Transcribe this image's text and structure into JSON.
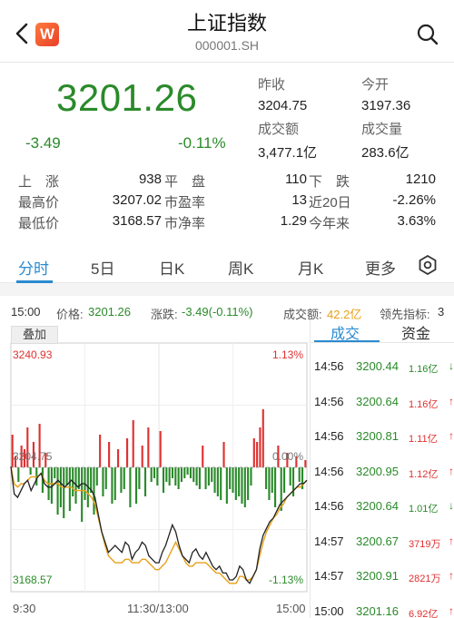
{
  "header": {
    "title": "上证指数",
    "code": "000001.SH",
    "logo_text": "W"
  },
  "quote": {
    "price": "3201.26",
    "change": "-3.49",
    "change_pct": "-0.11%",
    "prev_close_label": "昨收",
    "prev_close": "3204.75",
    "open_label": "今开",
    "open": "3197.36",
    "turnover_label": "成交额",
    "turnover": "3,477.1亿",
    "volume_label": "成交量",
    "volume": "283.6亿"
  },
  "stats": [
    {
      "l1": "上　涨",
      "v1": "938",
      "l2": "平　盘",
      "v2": "110",
      "l3": "下　跌",
      "v3": "1210"
    },
    {
      "l1": "最高价",
      "v1": "3207.02",
      "l2": "市盈率",
      "v2": "13",
      "l3": "近20日",
      "v3": "-2.26%"
    },
    {
      "l1": "最低价",
      "v1": "3168.57",
      "l2": "市净率",
      "v2": "1.29",
      "l3": "今年来",
      "v3": "3.63%"
    }
  ],
  "tabs": [
    "分时",
    "5日",
    "日K",
    "周K",
    "月K",
    "更多"
  ],
  "info": {
    "time": "15:00",
    "price_label": "价格:",
    "price": "3201.26",
    "chg_label": "涨跌:",
    "chg": "-3.49(-0.11%)",
    "amt_label": "成交额:",
    "amt": "42.2亿",
    "lead_label": "领先指标:",
    "lead": "3"
  },
  "overlay_label": "叠加",
  "axis": {
    "top_price": "3240.93",
    "top_pct": "1.13%",
    "mid_price": "3204.75",
    "mid_pct": "0.00%",
    "bottom_price": "3168.57",
    "bottom_pct": "-1.13%",
    "times": [
      "9:30",
      "11:30/13:00",
      "15:00"
    ]
  },
  "colors": {
    "up": "#e03030",
    "down": "#2a8a2a",
    "accent": "#2a8ad0",
    "avg_line": "#e6a11a",
    "price_line": "#222222"
  },
  "trade_panel": {
    "tabs": [
      "成交",
      "资金"
    ],
    "rows": [
      {
        "time": "14:56",
        "price": "3200.44",
        "vol": "1.16亿",
        "dir": "down"
      },
      {
        "time": "14:56",
        "price": "3200.64",
        "vol": "1.16亿",
        "dir": "up"
      },
      {
        "time": "14:56",
        "price": "3200.81",
        "vol": "1.11亿",
        "dir": "up"
      },
      {
        "time": "14:56",
        "price": "3200.95",
        "vol": "1.12亿",
        "dir": "up"
      },
      {
        "time": "14:56",
        "price": "3200.64",
        "vol": "1.01亿",
        "dir": "down"
      },
      {
        "time": "14:57",
        "price": "3200.67",
        "vol": "3719万",
        "dir": "up"
      },
      {
        "time": "14:57",
        "price": "3200.91",
        "vol": "2821万",
        "dir": "up"
      },
      {
        "time": "15:00",
        "price": "3201.16",
        "vol": "6.92亿",
        "dir": "up"
      }
    ]
  },
  "chart_data": {
    "type": "line",
    "title": "",
    "xlabel": "",
    "ylabel": "",
    "ylim": [
      3168.57,
      3240.93
    ],
    "x_ticks": [
      "9:30",
      "11:30/13:00",
      "15:00"
    ],
    "series": [
      {
        "values": [
          3205,
          3197,
          3196,
          3198,
          3200,
          3201,
          3198,
          3200,
          3202,
          3203,
          3200,
          3199,
          3199,
          3200,
          3201,
          3200,
          3199,
          3200,
          3201,
          3200,
          3199,
          3200,
          3200,
          3199,
          3198,
          3196,
          3191,
          3186,
          3183,
          3180,
          3181,
          3182,
          3181,
          3180,
          3183,
          3182,
          3178,
          3180,
          3181,
          3183,
          3182,
          3179,
          3178,
          3177,
          3177,
          3180,
          3182,
          3185,
          3188,
          3186,
          3182,
          3179,
          3178,
          3177,
          3180,
          3181,
          3179,
          3178,
          3180,
          3178,
          3176,
          3175,
          3176,
          3174,
          3174,
          3172,
          3172,
          3173,
          3176,
          3175,
          3172,
          3171,
          3173,
          3175,
          3181,
          3185,
          3187,
          3189,
          3190,
          3192,
          3194,
          3195,
          3196,
          3197,
          3198,
          3199,
          3200,
          3200,
          3201
        ]
      },
      {
        "values": [
          3205,
          3200,
          3199,
          3200,
          3200,
          3201,
          3202,
          3202,
          3202,
          3203,
          3201,
          3200,
          3200,
          3200,
          3200,
          3199,
          3199,
          3199,
          3199,
          3198,
          3198,
          3198,
          3198,
          3197,
          3196,
          3194,
          3190,
          3186,
          3182,
          3179,
          3178,
          3177,
          3177,
          3177,
          3178,
          3178,
          3177,
          3177,
          3177,
          3178,
          3178,
          3177,
          3176,
          3175,
          3175,
          3176,
          3177,
          3179,
          3181,
          3183,
          3181,
          3179,
          3177,
          3176,
          3176,
          3177,
          3177,
          3177,
          3177,
          3176,
          3175,
          3174,
          3174,
          3173,
          3172,
          3171,
          3171,
          3171,
          3173,
          3173,
          3172,
          3172,
          3173,
          3175,
          3179,
          3183,
          3186,
          3188,
          3190,
          3191,
          3193,
          3194,
          3196,
          3197,
          3198,
          3199,
          3199,
          3200,
          3201
        ]
      }
    ],
    "bars": {
      "values": [
        18,
        6,
        -8,
        12,
        10,
        22,
        -4,
        14,
        -10,
        24,
        -14,
        8,
        -18,
        -20,
        -6,
        -26,
        -22,
        -28,
        -10,
        -24,
        -16,
        -20,
        -12,
        -30,
        -18,
        -22,
        -14,
        -26,
        -10,
        18,
        -16,
        -12,
        14,
        -20,
        -18,
        10,
        -14,
        -12,
        16,
        -22,
        26,
        -20,
        -12,
        12,
        -16,
        22,
        -8,
        -6,
        -10,
        20,
        -14,
        -8,
        -10,
        -6,
        -10,
        -12,
        -8,
        -6,
        -4,
        -6,
        -8,
        -10,
        -12,
        12,
        -12,
        -10,
        -8,
        -14,
        -16,
        -18,
        14,
        -20,
        -12,
        -14,
        -18,
        -16,
        -20,
        -22,
        -18,
        -10,
        16,
        14,
        22,
        32,
        -12,
        -18,
        -14,
        -22,
        12,
        -24,
        -14,
        8,
        -10,
        -16,
        6,
        -8,
        -12,
        4
      ]
    }
  }
}
